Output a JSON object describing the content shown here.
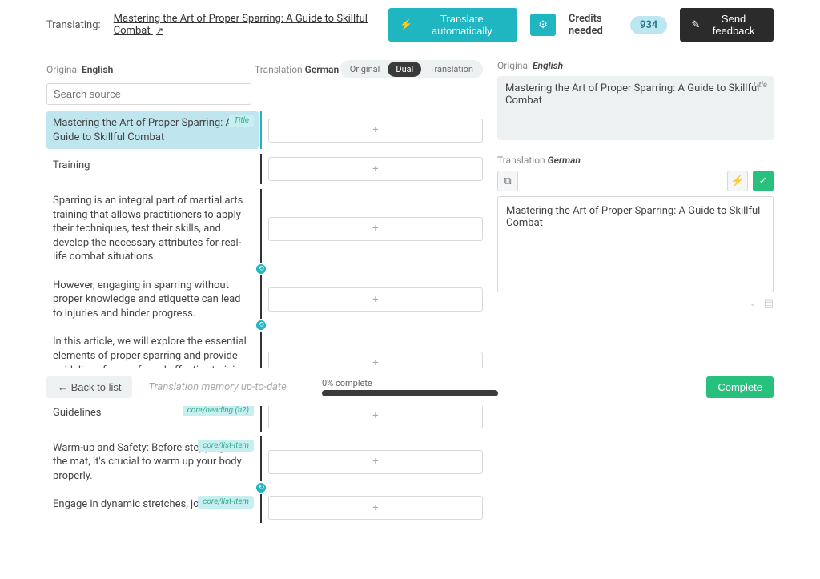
{
  "topbar": {
    "translating_label": "Translating:",
    "doc_title": "Mastering the Art of Proper Sparring: A Guide to Skillful Combat",
    "translate_auto": "Translate automatically",
    "credits_label": "Credits needed",
    "credits_value": "934",
    "feedback": "Send feedback"
  },
  "columns": {
    "original_label": "Original",
    "original_lang": "English",
    "translation_label": "Translation",
    "translation_lang": "German",
    "views": {
      "original": "Original",
      "dual": "Dual",
      "translation": "Translation"
    }
  },
  "search_placeholder": "Search source",
  "rows": [
    {
      "src": "Mastering the Art of Proper Sparring: A Guide to Skillful Combat",
      "tag": "Title",
      "selected": true,
      "link_after": false
    },
    {
      "src": "Training",
      "tag": "",
      "selected": false,
      "link_after": false
    },
    {
      "src": "Sparring is an integral part of martial arts training that allows practitioners to apply their techniques, test their skills, and develop the necessary attributes for real-life combat situations.",
      "tag": "",
      "selected": false,
      "link_after": true
    },
    {
      "src": "However, engaging in sparring without proper knowledge and etiquette can lead to injuries and hinder progress.",
      "tag": "",
      "selected": false,
      "link_after": true
    },
    {
      "src": "In this article, we will explore the essential elements of proper sparring and provide guidelines for a safe and effective training experience.",
      "tag": "",
      "selected": false,
      "link_after": false
    },
    {
      "src": "Guidelines",
      "tag": "core/heading (h2)",
      "selected": false,
      "link_after": false
    },
    {
      "src": "Warm-up and Safety: Before stepping onto the mat, it's crucial to warm up your body properly.",
      "tag": "core/list-item",
      "selected": false,
      "link_after": true
    },
    {
      "src": "Engage in dynamic stretches, joint",
      "tag": "core/list-item",
      "selected": false,
      "link_after": false
    }
  ],
  "plus_label": "+",
  "detail": {
    "original_text": "Mastering the Art of Proper Sparring: A Guide to Skillful Combat",
    "original_tag": "Title",
    "translation_text": "Mastering the Art of Proper Sparring: A Guide to Skillful Combat"
  },
  "bottom": {
    "back": "← Back to list",
    "tm_status": "Translation memory up-to-date",
    "progress": "0% complete",
    "complete": "Complete"
  }
}
